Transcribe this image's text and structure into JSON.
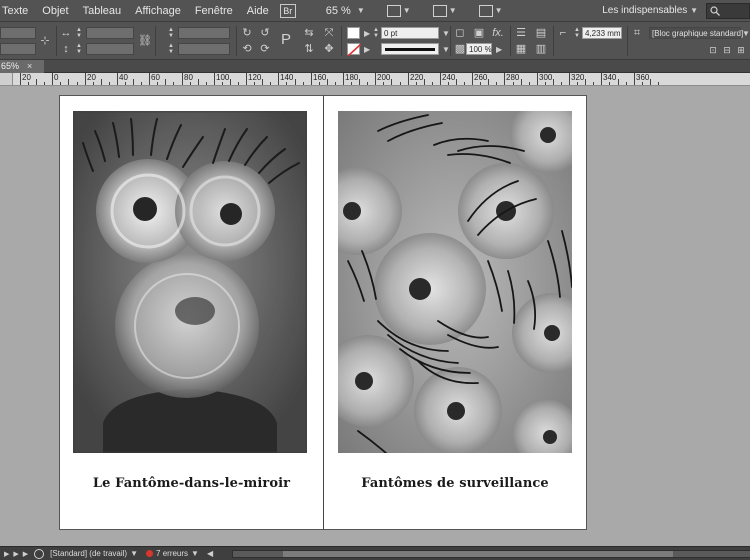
{
  "menubar": {
    "items": [
      "Texte",
      "Objet",
      "Tableau",
      "Affichage",
      "Fenêtre",
      "Aide"
    ],
    "bridge_label": "Br",
    "zoom_value": "65 %",
    "workspace_label": "Les indispensables"
  },
  "control_panel": {
    "stroke_weight": "0 pt",
    "stroke_opacity": "100 %",
    "measure_value": "4,233 mm",
    "object_style": "[Bloc graphique standard]",
    "fill_color": "#ffffff",
    "stroke_color": "#000000"
  },
  "tab": {
    "label": "65%",
    "close": "×"
  },
  "ruler": {
    "labels": [
      "20",
      "0",
      "20",
      "40",
      "60",
      "80",
      "100",
      "120",
      "140",
      "160",
      "180",
      "200",
      "220",
      "240",
      "260",
      "280",
      "300",
      "320",
      "340",
      "360"
    ]
  },
  "document": {
    "pages": [
      {
        "caption": "Le Fantôme-dans-le-miroir",
        "artwork": "ghost-portrait"
      },
      {
        "caption": "Fantômes de surveillance",
        "artwork": "surveillance-eyes"
      }
    ]
  },
  "statusbar": {
    "style_label": "[Standard] (de travail)",
    "errors": "7 erreurs",
    "error_color": "#d9362b"
  }
}
